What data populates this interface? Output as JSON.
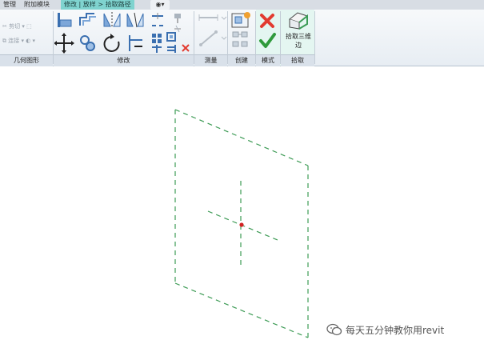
{
  "tabs": [
    {
      "label": "管理"
    },
    {
      "label": "附加模块"
    },
    {
      "label": "修改 | 放样 > 拾取路径"
    }
  ],
  "tab_extra": "◉▾",
  "geometry_panel": {
    "cut_label": "剪切",
    "join_label": "连接",
    "panel_label": "几何图形"
  },
  "panels": {
    "modify": "修改",
    "measure": "测量",
    "create": "创建",
    "mode": "模式",
    "pick": "拾取"
  },
  "pick_button": {
    "line1": "拾取三维",
    "line2": "边"
  },
  "watermark": {
    "text": "每天五分钟教你用revit"
  },
  "colors": {
    "accent_tab": "#7fd3cf",
    "cancel_red": "#e23b30",
    "finish_green": "#2f9a3c",
    "dashed_green": "#3d9b55",
    "point_red": "#d22222"
  }
}
